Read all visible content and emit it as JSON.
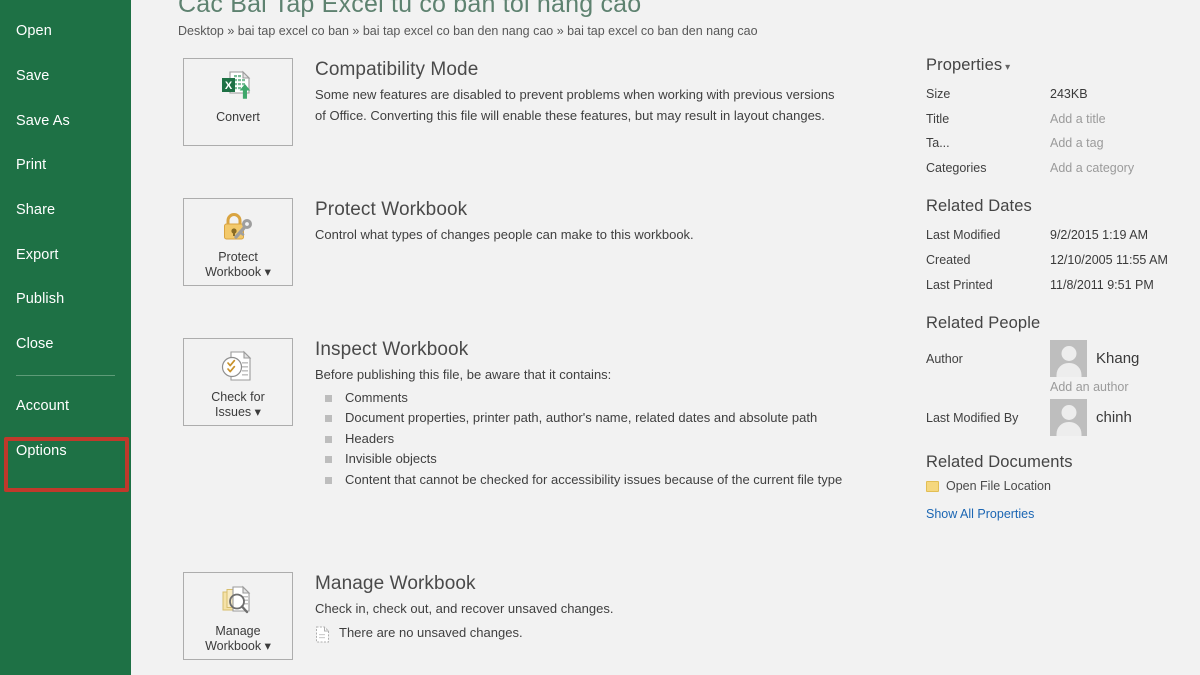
{
  "sidebar": {
    "items": [
      {
        "label": "Open"
      },
      {
        "label": "Save"
      },
      {
        "label": "Save As"
      },
      {
        "label": "Print"
      },
      {
        "label": "Share"
      },
      {
        "label": "Export"
      },
      {
        "label": "Publish"
      },
      {
        "label": "Close"
      }
    ],
    "account_label": "Account",
    "options_label": "Options",
    "highlight_color": "#C0392B",
    "background_color": "#1E7145"
  },
  "header": {
    "title": "Cac Bai Tap Excel tu co ban toi nang cao",
    "breadcrumb": "Desktop » bai tap excel co ban » bai tap excel co ban den nang cao » bai tap excel co ban den nang cao"
  },
  "sections": {
    "compatibility": {
      "button_label": "Convert",
      "icon": "excel-convert-icon",
      "heading": "Compatibility Mode",
      "description": "Some new features are disabled to prevent problems when working with previous versions of Office. Converting this file will enable these features, but may result in layout changes."
    },
    "protect": {
      "button_label": "Protect\nWorkbook",
      "button_label_line1": "Protect",
      "button_label_line2": "Workbook",
      "icon": "padlock-key-icon",
      "heading": "Protect Workbook",
      "description": "Control what types of changes people can make to this workbook."
    },
    "inspect": {
      "button_label_line1": "Check for",
      "button_label_line2": "Issues",
      "icon": "document-check-icon",
      "heading": "Inspect Workbook",
      "description": "Before publishing this file, be aware that it contains:",
      "bullets": [
        "Comments",
        "Document properties, printer path, author's name, related dates and absolute path",
        "Headers",
        "Invisible objects",
        "Content that cannot be checked for accessibility issues because of the current file type"
      ]
    },
    "manage": {
      "button_label_line1": "Manage",
      "button_label_line2": "Workbook",
      "icon": "documents-magnifier-icon",
      "heading": "Manage Workbook",
      "description": "Check in, check out, and recover unsaved changes.",
      "note": "There are no unsaved changes.",
      "note_icon": "blank-document-icon"
    }
  },
  "properties": {
    "heading": "Properties",
    "rows": [
      {
        "key": "Size",
        "value": "243KB",
        "placeholder": false
      },
      {
        "key": "Title",
        "value": "Add a title",
        "placeholder": true
      },
      {
        "key": "Ta...",
        "value": "Add a tag",
        "placeholder": true
      },
      {
        "key": "Categories",
        "value": "Add a category",
        "placeholder": true
      }
    ]
  },
  "related_dates": {
    "heading": "Related Dates",
    "rows": [
      {
        "key": "Last Modified",
        "value": "9/2/2015 1:19 AM"
      },
      {
        "key": "Created",
        "value": "12/10/2005 11:55 AM"
      },
      {
        "key": "Last Printed",
        "value": "11/8/2011 9:51 PM"
      }
    ]
  },
  "related_people": {
    "heading": "Related People",
    "author_key": "Author",
    "author_name": "Khang",
    "add_author": "Add an author",
    "modified_key": "Last Modified By",
    "modified_name": "chinh"
  },
  "related_documents": {
    "heading": "Related Documents",
    "open_file_location": "Open File Location",
    "show_all_properties": "Show All Properties",
    "link_color": "#1B66B3"
  }
}
